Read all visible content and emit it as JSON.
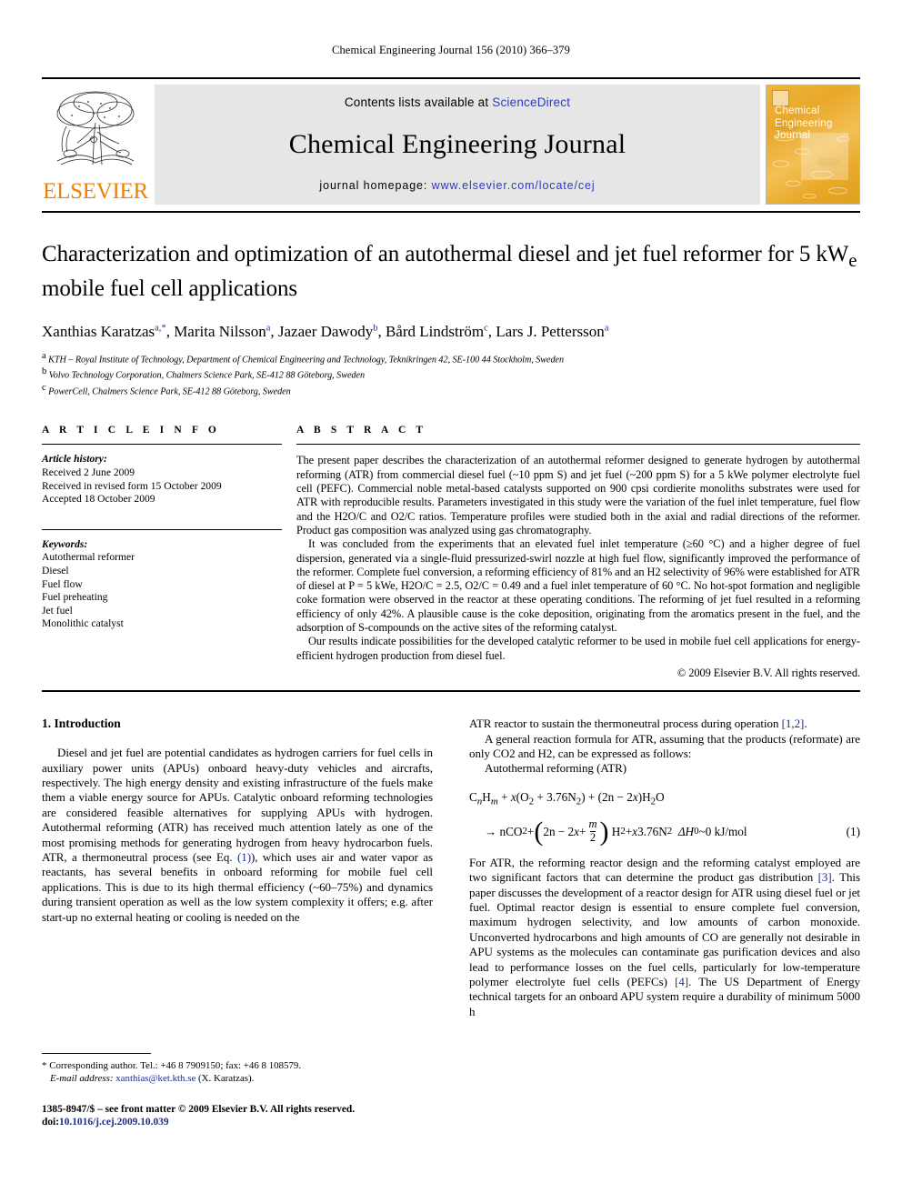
{
  "running_head": "Chemical Engineering Journal 156 (2010) 366–379",
  "masthead": {
    "contents_prefix": "Contents lists available at",
    "sciencedirect": "ScienceDirect",
    "journal_title": "Chemical Engineering Journal",
    "homepage_label": "journal homepage:",
    "homepage_url": "www.elsevier.com/locate/cej",
    "publisher_wordmark": "ELSEVIER",
    "cover_title_lines": [
      "Chemical",
      "Engineering",
      "Journal"
    ],
    "link_color": "#2b3bbd",
    "wordmark_color": "#f08000",
    "band_color": "#e6e6e6",
    "cover_color": "#e8a82a"
  },
  "article": {
    "title": "Characterization and optimization of an autothermal diesel and jet fuel reformer for 5 kW",
    "title_sub": "e",
    "title_tail": " mobile fuel cell applications",
    "authors": [
      {
        "name": "Xanthias Karatzas",
        "sup": "a,",
        "star": "*",
        "sep": ", "
      },
      {
        "name": "Marita Nilsson",
        "sup": "a",
        "star": "",
        "sep": ", "
      },
      {
        "name": "Jazaer Dawody",
        "sup": "b",
        "star": "",
        "sep": ", "
      },
      {
        "name": "Bård Lindström",
        "sup": "c",
        "star": "",
        "sep": ", "
      },
      {
        "name": "Lars J. Pettersson",
        "sup": "a",
        "star": "",
        "sep": ""
      }
    ],
    "affiliations": [
      {
        "mark": "a",
        "text": "KTH – Royal Institute of Technology, Department of Chemical Engineering and Technology, Teknikringen 42, SE-100 44 Stockholm, Sweden"
      },
      {
        "mark": "b",
        "text": "Volvo Technology Corporation, Chalmers Science Park, SE-412 88 Göteborg, Sweden"
      },
      {
        "mark": "c",
        "text": "PowerCell, Chalmers Science Park, SE-412 88 Göteborg, Sweden"
      }
    ]
  },
  "article_info": {
    "heading": "A R T I C L E   I N F O",
    "history_label": "Article history:",
    "history": [
      "Received 2 June 2009",
      "Received in revised form 15 October 2009",
      "Accepted 18 October 2009"
    ],
    "keywords_label": "Keywords:",
    "keywords": [
      "Autothermal reformer",
      "Diesel",
      "Fuel flow",
      "Fuel preheating",
      "Jet fuel",
      "Monolithic catalyst"
    ]
  },
  "abstract": {
    "heading": "A B S T R A C T",
    "paragraphs": [
      "The present paper describes the characterization of an autothermal reformer designed to generate hydrogen by autothermal reforming (ATR) from commercial diesel fuel (~10 ppm S) and jet fuel (~200 ppm S) for a 5 kWe polymer electrolyte fuel cell (PEFC). Commercial noble metal-based catalysts supported on 900 cpsi cordierite monoliths substrates were used for ATR with reproducible results. Parameters investigated in this study were the variation of the fuel inlet temperature, fuel flow and the H2O/C and O2/C ratios. Temperature profiles were studied both in the axial and radial directions of the reformer. Product gas composition was analyzed using gas chromatography.",
      "It was concluded from the experiments that an elevated fuel inlet temperature (≥60 °C) and a higher degree of fuel dispersion, generated via a single-fluid pressurized-swirl nozzle at high fuel flow, significantly improved the performance of the reformer. Complete fuel conversion, a reforming efficiency of 81% and an H2 selectivity of 96% were established for ATR of diesel at P = 5 kWe, H2O/C = 2.5, O2/C = 0.49 and a fuel inlet temperature of 60 °C. No hot-spot formation and negligible coke formation were observed in the reactor at these operating conditions. The reforming of jet fuel resulted in a reforming efficiency of only 42%. A plausible cause is the coke deposition, originating from the aromatics present in the fuel, and the adsorption of S-compounds on the active sites of the reforming catalyst.",
      "Our results indicate possibilities for the developed catalytic reformer to be used in mobile fuel cell applications for energy-efficient hydrogen production from diesel fuel."
    ],
    "copyright": "© 2009 Elsevier B.V. All rights reserved."
  },
  "introduction": {
    "heading": "1. Introduction",
    "left_paragraph": "Diesel and jet fuel are potential candidates as hydrogen carriers for fuel cells in auxiliary power units (APUs) onboard heavy-duty vehicles and aircrafts, respectively. The high energy density and existing infrastructure of the fuels make them a viable energy source for APUs. Catalytic onboard reforming technologies are considered feasible alternatives for supplying APUs with hydrogen. Autothermal reforming (ATR) has received much attention lately as one of the most promising methods for generating hydrogen from heavy hydrocarbon fuels. ATR, a thermoneutral process (see Eq.",
    "left_ref": "(1)",
    "left_paragraph_tail": "), which uses air and water vapor as reactants, has several benefits in onboard reforming for mobile fuel cell applications. This is due to its high thermal efficiency (~60–75%) and dynamics during transient operation as well as the low system complexity it offers; e.g. after start-up no external heating or cooling is needed on the",
    "right_p1_head": "ATR reactor to sustain the thermoneutral process during operation",
    "right_p1_ref": "[1,2]",
    "right_p1_tail": ".",
    "right_p2": "A general reaction formula for ATR, assuming that the products (reformate) are only CO2 and H2, can be expressed as follows:",
    "right_p3": "Autothermal reforming (ATR)",
    "right_p4_head": "For ATR, the reforming reactor design and the reforming catalyst employed are two significant factors that can determine the product gas distribution ",
    "right_p4_ref1": "[3]",
    "right_p4_mid": ". This paper discusses the development of a reactor design for ATR using diesel fuel or jet fuel. Optimal reactor design is essential to ensure complete fuel conversion, maximum hydrogen selectivity, and low amounts of carbon monoxide. Unconverted hydrocarbons and high amounts of CO are generally not desirable in APU systems as the molecules can contaminate gas purification devices and also lead to performance losses on the fuel cells, particularly for low-temperature polymer electrolyte fuel cells (PEFCs) ",
    "right_p4_ref2": "[4]",
    "right_p4_tail": ". The US Department of Energy technical targets for an onboard APU system require a durability of minimum 5000 h"
  },
  "equation": {
    "number": "(1)",
    "line1_a": "C",
    "line1_n": "n",
    "line1_b": "H",
    "line1_m": "m",
    "line1_c": " + ",
    "line1_x": "x",
    "line1_d": "(O",
    "line1_2a": "2",
    "line1_e": " + 3.76N",
    "line1_2b": "2",
    "line1_f": ") + (2n − 2",
    "line1_x2": "x",
    "line1_g": ")H",
    "line1_2c": "2",
    "line1_h": "O",
    "line2_arrow": "→ nCO",
    "line2_2a": "2",
    "line2_plus": " + ",
    "line2_inner": "2n − 2",
    "line2_x": "x",
    "line2_plusx": " + ",
    "frac_num": "m",
    "frac_den": "2",
    "line2_h2": "H",
    "line2_2b": "2",
    "line2_tail": " + ",
    "line2_x3": "x",
    "line2_n2": "3.76N",
    "line2_2c": "2",
    "line2_dh": "ΔH",
    "line2_sup0": "0",
    "line2_energy": "~0 kJ/mol"
  },
  "footnotes": {
    "corresponding_star": "*",
    "corresponding": "Corresponding author. Tel.: +46 8 7909150; fax: +46 8 108579.",
    "email_label": "E-mail address:",
    "email": "xanthias@ket.kth.se",
    "email_owner": "(X. Karatzas).",
    "imprint_line1": "1385-8947/$ – see front matter © 2009 Elsevier B.V. All rights reserved.",
    "imprint_doi_label": "doi:",
    "imprint_doi": "10.1016/j.cej.2009.10.039"
  }
}
